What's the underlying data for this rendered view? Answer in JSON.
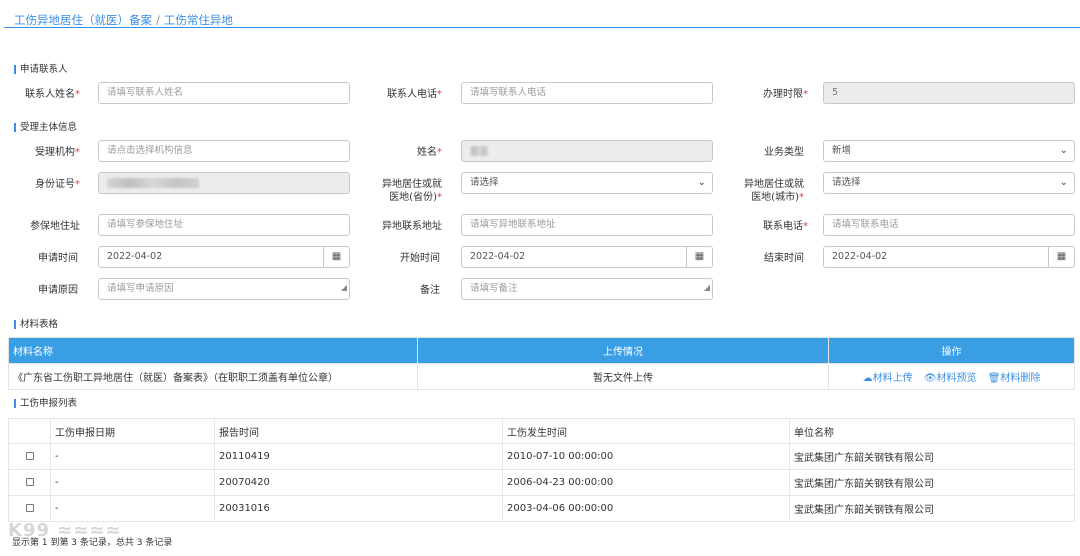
{
  "breadcrumb": {
    "item1": "工伤异地居住（就医）备案",
    "sep": "/",
    "item2": "工伤常住异地"
  },
  "sections": {
    "contact": "申请联系人",
    "subject": "受理主体信息",
    "materials": "材料表格",
    "injury": "工伤申报列表"
  },
  "form": {
    "contact_name_label": "联系人姓名",
    "contact_name_ph": "请填写联系人姓名",
    "contact_phone_label": "联系人电话",
    "contact_phone_ph": "请填写联系人电话",
    "deadline_label": "办理时限",
    "deadline_value": "5",
    "agency_label": "受理机构",
    "agency_ph": "请点击选择机构信息",
    "name_label": "姓名",
    "biz_type_label": "业务类型",
    "biz_type_value": "新增",
    "id_label": "身份证号",
    "province_label_1": "异地居住或就",
    "province_label_2": "医地(省份)",
    "province_value": "请选择",
    "city_label_1": "异地居住或就",
    "city_label_2": "医地(城市)",
    "city_value": "请选择",
    "insured_addr_label": "参保地住址",
    "insured_addr_ph": "请填写参保地住址",
    "remote_addr_label": "异地联系地址",
    "remote_addr_ph": "请填写异地联系地址",
    "phone_label": "联系电话",
    "phone_ph": "请填写联系电话",
    "apply_time_label": "申请时间",
    "apply_time_value": "2022-04-02",
    "start_time_label": "开始时间",
    "start_time_value": "2022-04-02",
    "end_time_label": "结束时间",
    "end_time_value": "2022-04-02",
    "reason_label": "申请原因",
    "reason_ph": "请填写申请原因",
    "remark_label": "备注",
    "remark_ph": "请填写备注",
    "required_mark": "*"
  },
  "materials": {
    "headers": [
      "材料名称",
      "上传情况",
      "操作"
    ],
    "row": {
      "name": "《广东省工伤职工异地居住（就医）备案表》（在职职工须盖有单位公章）",
      "status": "暂无文件上传",
      "upload": "材料上传",
      "preview": "材料预览",
      "delete": "材料删除"
    }
  },
  "injury": {
    "headers": [
      "",
      "工伤申报日期",
      "报告时间",
      "工伤发生时间",
      "单位名称"
    ],
    "rows": [
      {
        "date": "-",
        "report": "20110419",
        "occur": "2010-07-10 00:00:00",
        "unit": "宝武集团广东韶关钢铁有限公司"
      },
      {
        "date": "-",
        "report": "20070420",
        "occur": "2006-04-23 00:00:00",
        "unit": "宝武集团广东韶关钢铁有限公司"
      },
      {
        "date": "-",
        "report": "20031016",
        "occur": "2003-04-06 00:00:00",
        "unit": "宝武集团广东韶关钢铁有限公司"
      }
    ]
  },
  "footer": "显示第 1 到第 3 条记录，总共 3 条记录",
  "icons": {
    "calendar": "calendar-icon",
    "chevron": "chevron-down-icon",
    "upload": "upload-icon",
    "preview": "eye-icon",
    "delete": "trash-icon"
  },
  "colors": {
    "accent": "#3a8ee6",
    "header_bg": "#3a9ee4",
    "required": "#e4393c"
  }
}
